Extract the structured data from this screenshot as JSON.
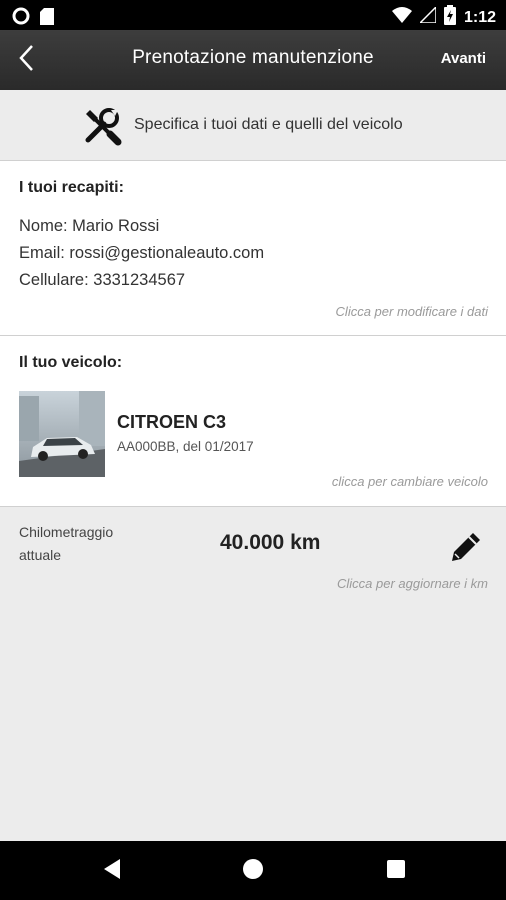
{
  "status_bar": {
    "time": "1:12"
  },
  "app_bar": {
    "title": "Prenotazione manutenzione",
    "next_label": "Avanti"
  },
  "instruction": {
    "text": "Specifica i tuoi dati e quelli del veicolo"
  },
  "contacts": {
    "title": "I tuoi recapiti:",
    "name": "Nome: Mario Rossi",
    "email": "Email: rossi@gestionaleauto.com",
    "phone": "Cellulare: 3331234567",
    "hint": "Clicca per modificare i dati"
  },
  "vehicle": {
    "title": "Il tuo veicolo:",
    "model": "CITROEN C3",
    "details": "AA000BB, del 01/2017",
    "hint": "clicca per cambiare veicolo"
  },
  "mileage": {
    "label": "Chilometraggio attuale",
    "value": "40.000 km",
    "hint": "Clicca per aggiornare i km"
  },
  "icons": [
    "circle-notification-icon",
    "sd-card-icon",
    "wifi-icon",
    "no-sim-icon",
    "battery-icon",
    "back-arrow-icon",
    "tools-icon",
    "car-photo",
    "pencil-icon",
    "nav-back-icon",
    "nav-home-icon",
    "nav-recents-icon"
  ]
}
